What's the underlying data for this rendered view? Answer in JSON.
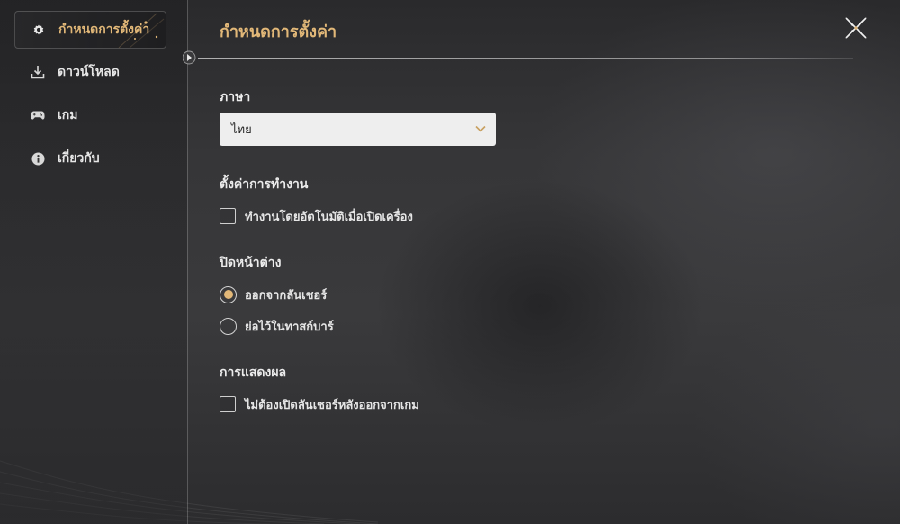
{
  "colors": {
    "accent": "#e2b878",
    "text": "#e6e6e6",
    "select_bg": "#eeeeee"
  },
  "sidebar": {
    "items": [
      {
        "label": "กำหนดการตั้งค่า",
        "icon": "gear-icon",
        "active": true
      },
      {
        "label": "ดาวน์โหลด",
        "icon": "download-icon",
        "active": false
      },
      {
        "label": "เกม",
        "icon": "gamepad-icon",
        "active": false
      },
      {
        "label": "เกี่ยวกับ",
        "icon": "info-icon",
        "active": false
      }
    ]
  },
  "header": {
    "title": "กำหนดการตั้งค่า",
    "close_icon": "close-icon"
  },
  "settings": {
    "language": {
      "title": "ภาษา",
      "selected": "ไทย",
      "icon": "chevron-down-icon"
    },
    "startup": {
      "title": "ตั้งค่าการทำงาน",
      "auto_start_label": "ทำงานโดยอัตโนมัติเมื่อเปิดเครื่อง",
      "auto_start_checked": false
    },
    "close_window": {
      "title": "ปิดหน้าต่าง",
      "options": [
        {
          "label": "ออกจากลันเชอร์",
          "selected": true
        },
        {
          "label": "ย่อไว้ในทาสก์บาร์",
          "selected": false
        }
      ]
    },
    "display": {
      "title": "การแสดงผล",
      "no_reopen_label": "ไม่ต้องเปิดลันเชอร์หลังออกจากเกม",
      "no_reopen_checked": false
    }
  }
}
